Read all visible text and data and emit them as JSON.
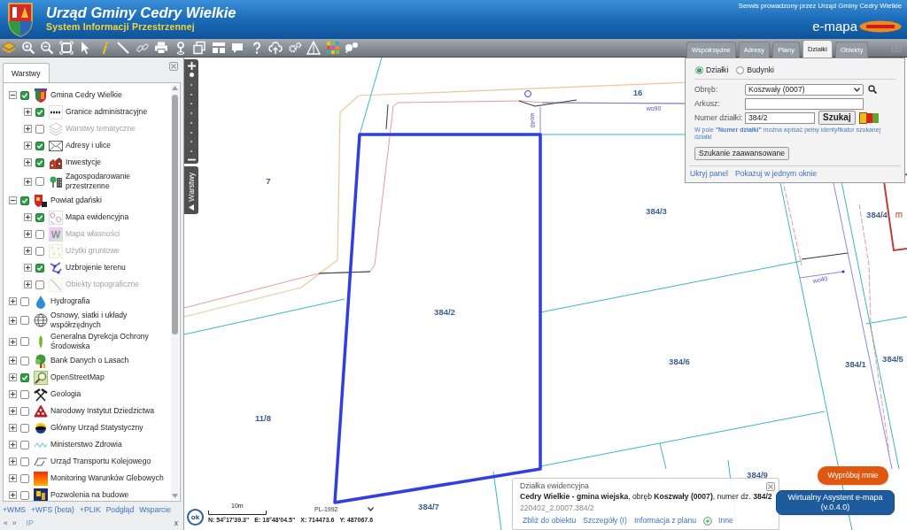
{
  "header": {
    "title": "Urząd Gminy Cedry Wielkie",
    "subtitle": "System Informacji Przestrzennej",
    "operator_note": "Serwis prowadzony przez Urząd Gminy Cedry Wielkie",
    "brand": "e-mapa"
  },
  "search_panel": {
    "tabs": [
      {
        "label": "Współrzędne",
        "selected": false
      },
      {
        "label": "Adresy",
        "selected": false
      },
      {
        "label": "Plany",
        "selected": false
      },
      {
        "label": "Działki",
        "selected": true
      },
      {
        "label": "Obiekty",
        "selected": false
      }
    ],
    "modes": [
      {
        "label": "Działki",
        "selected": true
      },
      {
        "label": "Budynki",
        "selected": false
      }
    ],
    "fields": [
      {
        "label": "Obręb:",
        "kind": "select",
        "value": "Koszwały (0007)"
      },
      {
        "label": "Arkusz:",
        "kind": "text"
      },
      {
        "label": "Numer działki:",
        "kind": "text",
        "value": "384/2"
      }
    ],
    "search_button": "Szukaj",
    "highlight_colors": [
      {
        "color": "#f3b81f",
        "selected": true
      },
      {
        "color": "#e51b1b",
        "selected": false
      },
      {
        "color": "#5ea52e",
        "selected": false
      }
    ],
    "hint": "W pole **\"Numer działki\"** można wpisać pełny identyfikator szukanej działki",
    "advanced_button": "Szukanie zaawansowane",
    "links": [
      "Ukryj panel",
      "Pokazuj w jednym oknie"
    ]
  },
  "layers_panel": {
    "tab": "Warstwy",
    "layers": [
      {
        "label": "Gmina Cedry Wielkie",
        "checked": true,
        "expanded": true,
        "disabled": false,
        "children": [
          {
            "label": "Granice administracyjne",
            "checked": true,
            "expanded": false,
            "disabled": false
          },
          {
            "label": "Warstwy tematyczne",
            "checked": false,
            "expanded": false,
            "disabled": true
          },
          {
            "label": "Adresy i ulice",
            "checked": true,
            "expanded": false,
            "disabled": false
          },
          {
            "label": "Inwestycje",
            "checked": true,
            "expanded": false,
            "disabled": false
          },
          {
            "label": "Zagospodarowanie przestrzenne",
            "checked": false,
            "expanded": false,
            "disabled": false
          }
        ]
      },
      {
        "label": "Powiat gdański",
        "checked": true,
        "expanded": true,
        "disabled": false,
        "children": [
          {
            "label": "Mapa ewidencyjna",
            "checked": true,
            "expanded": false,
            "disabled": false
          },
          {
            "label": "Mapa własności",
            "checked": false,
            "expanded": false,
            "disabled": true,
            "icon_text": "W"
          },
          {
            "label": "Użytki gruntowe",
            "checked": false,
            "expanded": false,
            "disabled": true
          },
          {
            "label": "Uzbrojenie terenu",
            "checked": true,
            "expanded": false,
            "disabled": false
          },
          {
            "label": "Obiekty topograficzne",
            "checked": false,
            "expanded": false,
            "disabled": true
          }
        ]
      },
      {
        "label": "Hydrografia",
        "checked": false,
        "expanded": false,
        "disabled": false
      },
      {
        "label": "Osnowy, siatki i układy współrzędnych",
        "checked": false,
        "expanded": false,
        "disabled": false
      },
      {
        "label": "Generalna Dyrekcja Ochrony Środowiska",
        "checked": false,
        "expanded": false,
        "disabled": false
      },
      {
        "label": "Bank Danych o Lasach",
        "checked": false,
        "expanded": false,
        "disabled": false
      },
      {
        "label": "OpenStreetMap",
        "checked": true,
        "expanded": false,
        "disabled": false
      },
      {
        "label": "Geologia",
        "checked": false,
        "expanded": false,
        "disabled": false
      },
      {
        "label": "Narodowy Instytut Dziedzictwa",
        "checked": false,
        "expanded": false,
        "disabled": false
      },
      {
        "label": "Główny Urząd Statystyczny",
        "checked": false,
        "expanded": false,
        "disabled": false
      },
      {
        "label": "Ministerstwo Zdrowia",
        "checked": false,
        "expanded": false,
        "disabled": false
      },
      {
        "label": "Urząd Transportu Kolejowego",
        "checked": false,
        "expanded": false,
        "disabled": false
      },
      {
        "label": "Monitoring Warunków Glebowych",
        "checked": false,
        "expanded": false,
        "disabled": false
      },
      {
        "label": "Pozwolenia na budowe",
        "checked": false,
        "expanded": false,
        "disabled": false
      }
    ],
    "actions": [
      "+WMS",
      "+WFS (beta)",
      "+PLIK",
      "Podgląd",
      "Wsparcie"
    ],
    "pager": [
      "«",
      "»"
    ],
    "ip_link": "IP",
    "close_link": "x"
  },
  "map": {
    "side_tab": "Warstwy",
    "zoom_slider": {
      "level": 1
    },
    "parcel_labels": [
      "16",
      "7",
      "384/3",
      "384/4",
      "384/2",
      "384/6",
      "384/1",
      "384/5",
      "11/8",
      "384/9",
      "384/7"
    ],
    "building_labels": [
      "m"
    ],
    "line_labels": [
      "wo90",
      "wo40",
      "wo40"
    ],
    "ok_button": "ok",
    "scale_label": "10m",
    "coordinates": [
      "N: 54°17'39.3\"",
      "E: 18°48'04.5\"",
      "X: 714473.6",
      "Y: 487067.6"
    ],
    "projection": "PL-1992"
  },
  "info_popup": {
    "heading": "Działka ewidencyjna",
    "description": "**Cedry Wielkie - gmina wiejska**, obręb **Koszwały (0007)**, numer dz. **384/2**",
    "identifier": "220402_2.0007.384/2",
    "actions": [
      "Zbliż do obiektu",
      "Szczegóły (I)",
      "Informacja z planu",
      "Inne"
    ]
  },
  "assistant": {
    "try_button": "Wypróbuj mnie",
    "launch_button": [
      "Wirtualny Asystent e-mapa",
      "(v.0.4.0)"
    ]
  }
}
